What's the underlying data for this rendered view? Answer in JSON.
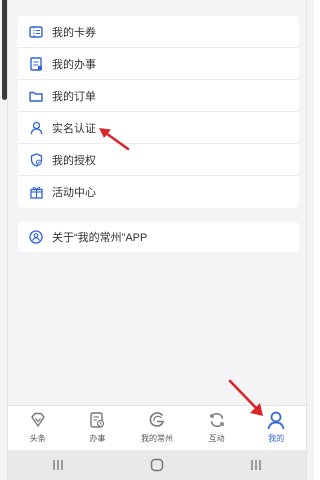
{
  "menu": {
    "items": [
      {
        "label": "我的卡券",
        "icon": "ticket-icon"
      },
      {
        "label": "我的办事",
        "icon": "document-icon"
      },
      {
        "label": "我的订单",
        "icon": "folder-icon"
      },
      {
        "label": "实名认证",
        "icon": "user-icon"
      },
      {
        "label": "我的授权",
        "icon": "shield-icon"
      },
      {
        "label": "活动中心",
        "icon": "gift-icon"
      }
    ]
  },
  "about": {
    "label": "关于“我的常州”APP",
    "icon": "app-logo-icon"
  },
  "tabbar": {
    "tabs": [
      {
        "label": "头条",
        "icon": "diamond-icon",
        "active": false
      },
      {
        "label": "办事",
        "icon": "clipboard-icon",
        "active": false
      },
      {
        "label": "我的常州",
        "icon": "g-logo-icon",
        "active": false
      },
      {
        "label": "互动",
        "icon": "refresh-icon",
        "active": false
      },
      {
        "label": "我的",
        "icon": "person-icon",
        "active": true
      }
    ]
  },
  "colors": {
    "accent": "#2e63d6",
    "annotation_arrow": "#d9262b",
    "background": "#f4f4f6"
  }
}
